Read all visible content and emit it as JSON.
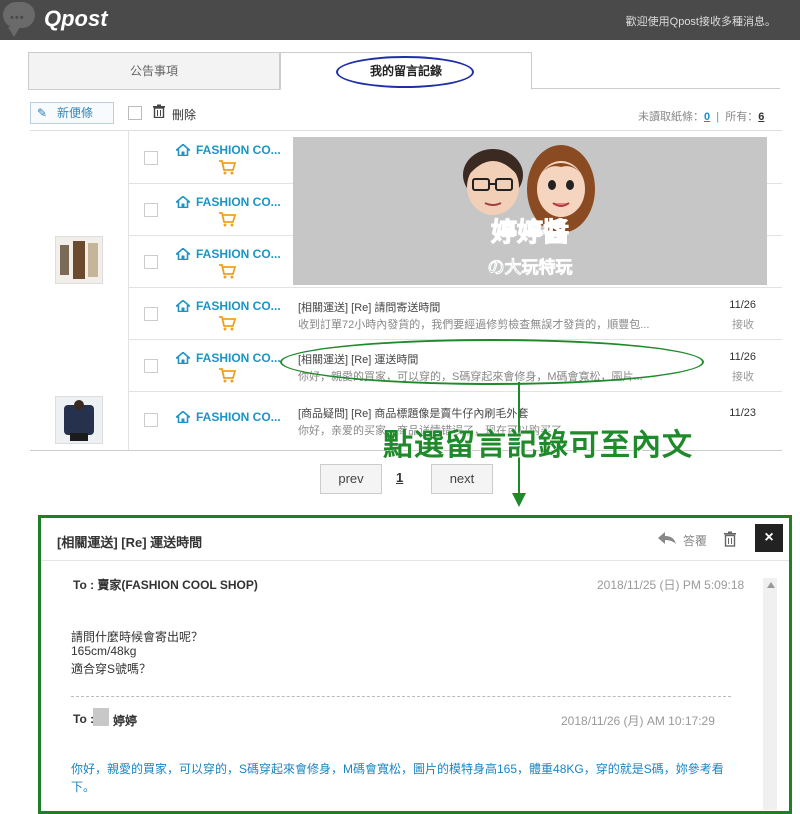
{
  "header": {
    "logo": "Qpost",
    "welcome": "歡迎使用Qpost接收多種消息。"
  },
  "tabs": [
    {
      "label": "公告事項"
    },
    {
      "label": "我的留言記錄"
    }
  ],
  "toolbar": {
    "new_note": "新便條",
    "delete": "刪除",
    "unread_label": "未讀取紙條：",
    "unread_count": "0",
    "separator": "|",
    "total_label": "所有：",
    "total_count": "6"
  },
  "messages": [
    {
      "shop": "FASHION CO...",
      "subject": "",
      "preview": "",
      "date": "",
      "status": ""
    },
    {
      "shop": "FASHION CO...",
      "subject": "",
      "preview": "",
      "date": "",
      "status": ""
    },
    {
      "shop": "FASHION CO...",
      "subject": "",
      "preview": "",
      "date": "",
      "status": ""
    },
    {
      "shop": "FASHION CO...",
      "subject": "[相關運送] [Re] 請問寄送時間",
      "preview": "收到訂單72小時內發貨的，我們要經過修剪檢查無誤才發貨的，順豐包...",
      "date": "11/26",
      "status": "接收"
    },
    {
      "shop": "FASHION CO...",
      "subject": "[相關運送] [Re] 運送時間",
      "preview": "你好，親愛的買家，可以穿的，S碼穿起來會修身，M碼會寬松，圖片...",
      "date": "11/26",
      "status": "接收"
    },
    {
      "shop": "FASHION CO...",
      "subject": "[商品疑問] [Re] 商品標題像是賣牛仔內刷毛外套",
      "preview": "你好，亲爱的买家，商品详情错误了，现在可以购买了。",
      "date": "11/23",
      "status": ""
    }
  ],
  "pagination": {
    "prev": "prev",
    "page": "1",
    "next": "next"
  },
  "annotation": {
    "text": "點選留言記錄可至內文"
  },
  "overlay": {
    "logo_line1": "婷婷醬",
    "logo_line2": "の大玩特玩"
  },
  "modal": {
    "title": "[相關運送] [Re] 運送時間",
    "reply": "答覆",
    "close": "×",
    "to1": "To : 賣家(FASHION COOL SHOP)",
    "time1": "2018/11/25 (日) PM 5:09:18",
    "body1_line1": "請問什麼時候會寄出呢？",
    "body1_line2": "165cm/48kg",
    "body1_line3": "適合穿S號嗎？",
    "to2_prefix": "To :",
    "to2_name": "婷婷",
    "time2": "2018/11/26 (月) AM 10:17:29",
    "body2": "你好，親愛的買家，可以穿的，S碼穿起來會修身，M碼會寬松，圖片的模特身高165，體重48KG，穿的就是S碼，妳參考看下。"
  },
  "colors": {
    "accent": "#1c94c4",
    "annotation": "#1f8a2a",
    "tab_highlight": "#1f2fa8"
  }
}
